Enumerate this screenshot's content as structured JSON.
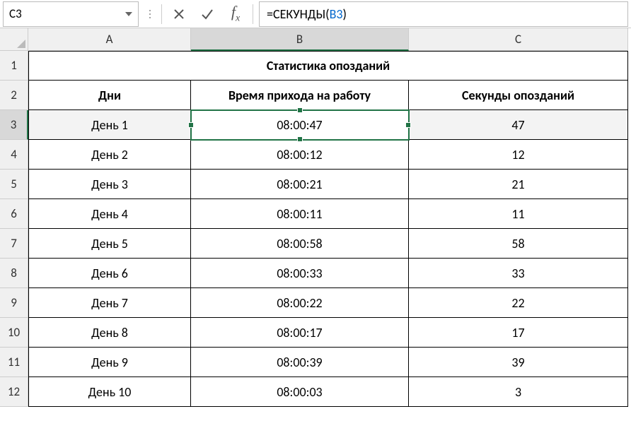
{
  "formula_bar": {
    "name_box": "C3",
    "formula_eq": "=",
    "formula_fn": "СЕКУНДЫ",
    "formula_open": "(",
    "formula_ref": "B3",
    "formula_close": ")"
  },
  "columns": {
    "A": "A",
    "B": "B",
    "C": "C"
  },
  "rows": {
    "r1": "1",
    "r2": "2",
    "r3": "3",
    "r4": "4",
    "r5": "5",
    "r6": "6",
    "r7": "7",
    "r8": "8",
    "r9": "9",
    "r10": "10",
    "r11": "11",
    "r12": "12"
  },
  "title": "Статистика опозданий",
  "headers": {
    "a": "Дни",
    "b": "Время прихода на работу",
    "c": "Секунды опозданий"
  },
  "data": [
    {
      "day": "День 1",
      "time": "08:00:47",
      "sec": "47"
    },
    {
      "day": "День 2",
      "time": "08:00:12",
      "sec": "12"
    },
    {
      "day": "День 3",
      "time": "08:00:21",
      "sec": "21"
    },
    {
      "day": "День 4",
      "time": "08:00:11",
      "sec": "11"
    },
    {
      "day": "День 5",
      "time": "08:00:58",
      "sec": "58"
    },
    {
      "day": "День 6",
      "time": "08:00:33",
      "sec": "33"
    },
    {
      "day": "День 7",
      "time": "08:00:22",
      "sec": "22"
    },
    {
      "day": "День 8",
      "time": "08:00:17",
      "sec": "17"
    },
    {
      "day": "День 9",
      "time": "08:00:39",
      "sec": "39"
    },
    {
      "day": "День 10",
      "time": "08:00:03",
      "sec": "3"
    }
  ]
}
